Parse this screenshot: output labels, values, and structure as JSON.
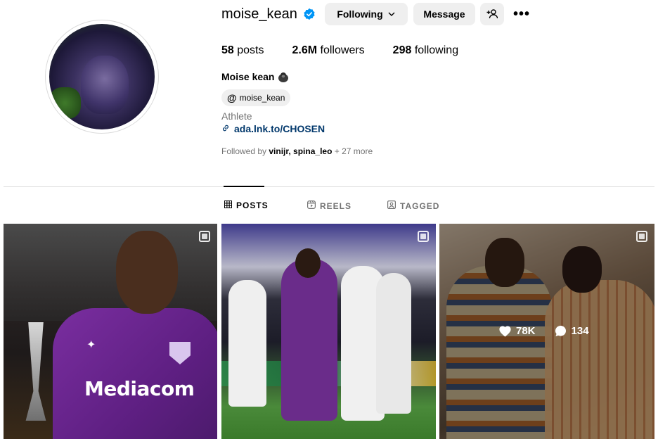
{
  "profile": {
    "username": "moise_kean",
    "following_label": "Following",
    "message_label": "Message",
    "more_label": "•••",
    "stats": {
      "posts_count": "58",
      "posts_label": "posts",
      "followers_count": "2.6M",
      "followers_label": "followers",
      "following_count": "298",
      "following_label": "following"
    },
    "full_name": "Moise kean",
    "threads_handle": "moise_kean",
    "category": "Athlete",
    "link": "ada.lnk.to/CHOSEN",
    "followed_by_prefix": "Followed by",
    "followed_by_names": "vinijr, spina_leo",
    "followed_by_more": "+ 27 more"
  },
  "tabs": [
    {
      "label": "POSTS",
      "icon": "grid-icon",
      "active": true
    },
    {
      "label": "REELS",
      "icon": "reels-icon",
      "active": false
    },
    {
      "label": "TAGGED",
      "icon": "tagged-icon",
      "active": false
    }
  ],
  "posts": [
    {
      "type": "carousel",
      "caption_text": "Mediacom"
    },
    {
      "type": "carousel"
    },
    {
      "type": "carousel",
      "likes": "78K",
      "comments": "134"
    }
  ],
  "colors": {
    "link": "#00376b",
    "button_bg": "#efefef",
    "muted_text": "#737373",
    "verified": "#0095f6"
  }
}
